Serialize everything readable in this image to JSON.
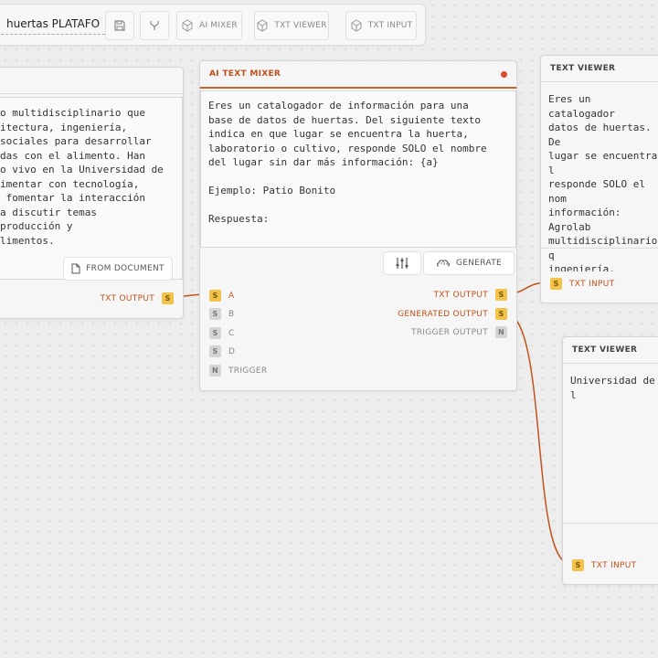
{
  "toolbar": {
    "title": "huertas PLATAFO",
    "save_icon": "save-icon",
    "fork_icon": "fork-icon",
    "ai_mixer_label": "AI MIXER",
    "txt_viewer_label": "TXT VIEWER",
    "txt_input_label": "TXT INPUT"
  },
  "left_node": {
    "text": "o multidisciplinario que\nitectura, ingeniería,\nsociales para desarrollar\ndas con el alimento. Han\no vivo en la Universidad de\nimentar con tecnología,\n fomentar la interacción\na discutir temas\nproducción y\nlimentos.",
    "from_document_label": "FROM DOCUMENT",
    "output_label": "TXT OUTPUT",
    "output_badge": "S"
  },
  "mixer": {
    "title": "AI TEXT MIXER",
    "prompt": "Eres un catalogador de información para una\nbase de datos de huertas. Del siguiente texto\nindica en que lugar se encuentra la huerta,\nlaboratorio o cultivo, responde SOLO el nombre\ndel lugar sin dar más información: {a}\n\nEjemplo: Patio Bonito\n\nRespuesta:",
    "generate_label": "GENERATE",
    "inputs": [
      {
        "badge": "S",
        "label": "A"
      },
      {
        "badge": "S",
        "label": "B"
      },
      {
        "badge": "S",
        "label": "C"
      },
      {
        "badge": "S",
        "label": "D"
      },
      {
        "badge": "N",
        "label": "TRIGGER"
      }
    ],
    "outputs": [
      {
        "label": "TXT OUTPUT",
        "badge": "S"
      },
      {
        "label": "GENERATED OUTPUT",
        "badge": "S"
      },
      {
        "label": "TRIGGER OUTPUT",
        "badge": "N"
      }
    ]
  },
  "viewer1": {
    "title": "TEXT VIEWER",
    "text": "Eres un catalogador\ndatos de huertas. De\nlugar se encuentra l\nresponde SOLO el nom\ninformación: Agrolab\nmultidisciplinario q\ningeniería, biología\ndesarrollar solucion\nHan creado un labora\nlos Andes para exper\nde cultivo y fomenta\ncomunidad para discu",
    "input_badge": "S",
    "input_label": "TXT INPUT"
  },
  "viewer2": {
    "title": "TEXT VIEWER",
    "text": "Universidad de l",
    "input_badge": "S",
    "input_label": "TXT INPUT"
  },
  "colors": {
    "accent": "#c0501a",
    "wire": "#c0541c",
    "badge_s": "#f3c24a",
    "badge_n": "#d6d6d6",
    "status_dot": "#d94a2a"
  }
}
